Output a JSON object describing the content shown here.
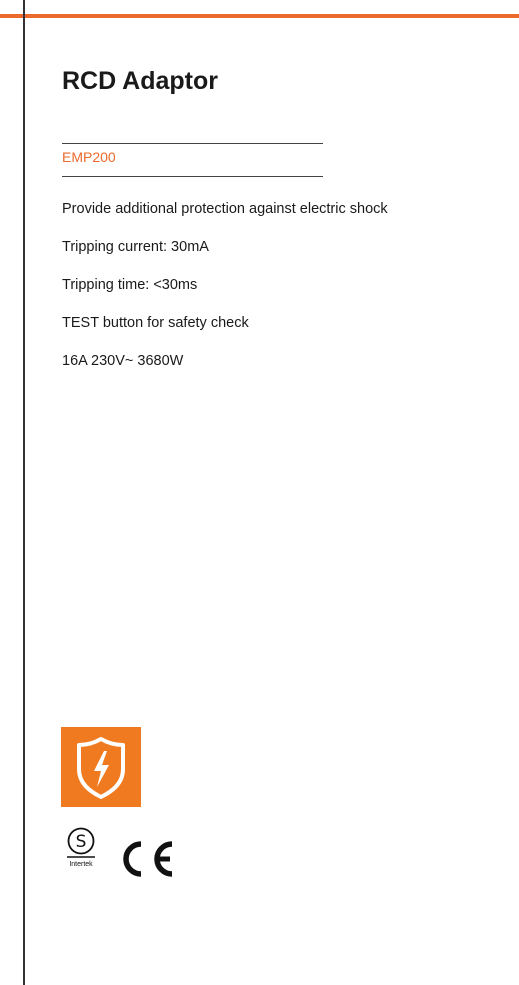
{
  "product": {
    "title": "RCD Adaptor",
    "model": "EMP200",
    "features": [
      "Provide additional protection against electric shock",
      "Tripping current: 30mA",
      "Tripping time: <30ms",
      "TEST button for safety check",
      "16A 230V~ 3680W"
    ]
  },
  "certifications": {
    "intertek_label": "Intertek",
    "icons": [
      "shock-protection-shield-icon",
      "intertek-s-mark-icon",
      "ce-mark-icon"
    ]
  },
  "colors": {
    "accent": "#ec6a2c",
    "badge": "#f07a1f",
    "text": "#1a1a1a",
    "rule": "#333333"
  }
}
